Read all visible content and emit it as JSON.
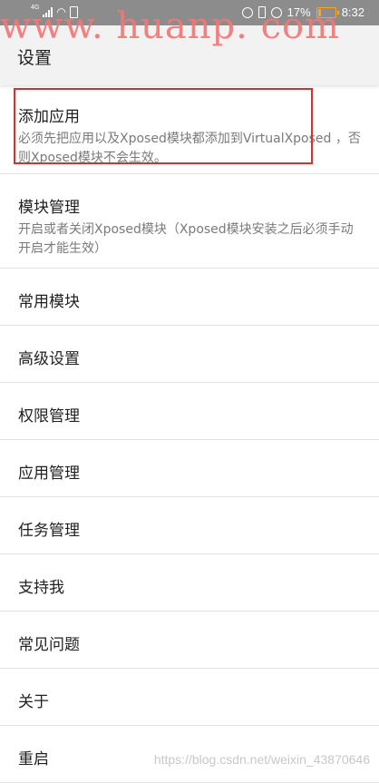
{
  "status_bar": {
    "network": "4G",
    "battery": "17%",
    "battery_level": 0.17,
    "time": "8:32",
    "icons": [
      "signal-icon",
      "wifi-icon",
      "sim-icon",
      "alarm-icon",
      "vibrate-icon",
      "rotation-icon",
      "battery-icon"
    ]
  },
  "watermark": "www. huanp. com",
  "header": {
    "title": "设置"
  },
  "settings": {
    "add_app": {
      "title": "添加应用",
      "desc": "必须先把应用以及Xposed模块都添加到VirtualXposed ，否则Xposed模块不会生效。"
    },
    "module_manage": {
      "title": "模块管理",
      "desc": "开启或者关闭Xposed模块（Xposed模块安装之后必须手动开启才能生效）"
    },
    "items": [
      "常用模块",
      "高级设置",
      "权限管理",
      "应用管理",
      "任务管理",
      "支持我",
      "常见问题",
      "关于",
      "重启"
    ]
  },
  "credit": "https://blog.csdn.net/weixin_43870646",
  "colors": {
    "status_bar": "#8c8c8c",
    "header_bg": "#f2f2f2",
    "highlight": "#d9302d",
    "watermark": "#f07878"
  }
}
